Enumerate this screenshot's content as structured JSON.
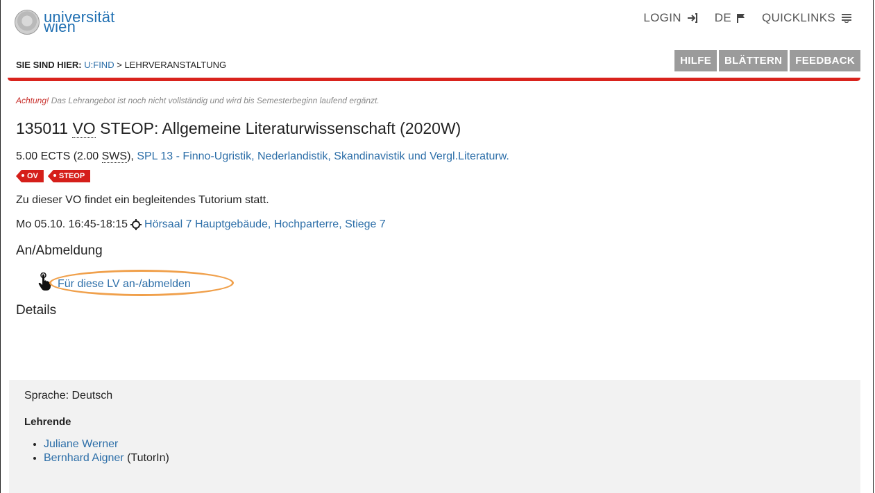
{
  "header": {
    "logo_line1": "universität",
    "logo_line2": "wien",
    "nav": {
      "login": "LOGIN",
      "lang": "DE",
      "quicklinks": "QUICKLINKS"
    },
    "breadcrumb": {
      "label": "SIE SIND HIER:",
      "ufind": "U:FIND",
      "sep": ">",
      "current": "LEHRVERANSTALTUNG"
    },
    "tools": [
      "HILFE",
      "BLÄTTERN",
      "FEEDBACK"
    ],
    "accent_color": "#d9231d"
  },
  "notice": {
    "warn": "Achtung!",
    "text": "Das Lehrangebot ist noch nicht vollständig und wird bis Semesterbeginn laufend ergänzt."
  },
  "course": {
    "number": "135011",
    "type": "VO",
    "name": "STEOP: Allgemeine Literaturwissenschaft (2020W)",
    "ects_prefix": "5.00 ECTS (2.00",
    "sws": "SWS",
    "ects_suffix": "),",
    "spl": "SPL 13 - Finno-Ugristik, Nederlandistik, Skandinavistik und Vergl.Literaturw.",
    "tags": [
      "OV",
      "STEOP"
    ],
    "tutorium": "Zu dieser VO findet ein begleitendes Tutorium statt.",
    "time": "Mo 05.10. 16:45-18:15",
    "location": "Hörsaal 7 Hauptgebäude, Hochparterre, Stiege 7"
  },
  "registration": {
    "heading": "An/Abmeldung",
    "link": "Für diese LV an-/abmelden",
    "highlight_color": "#f0a04b"
  },
  "details": {
    "heading": "Details",
    "language": "Sprache: Deutsch",
    "lecturers_heading": "Lehrende",
    "lecturers": [
      {
        "name": "Juliane Werner",
        "role": ""
      },
      {
        "name": "Bernhard Aigner",
        "role": "(TutorIn)"
      }
    ]
  }
}
